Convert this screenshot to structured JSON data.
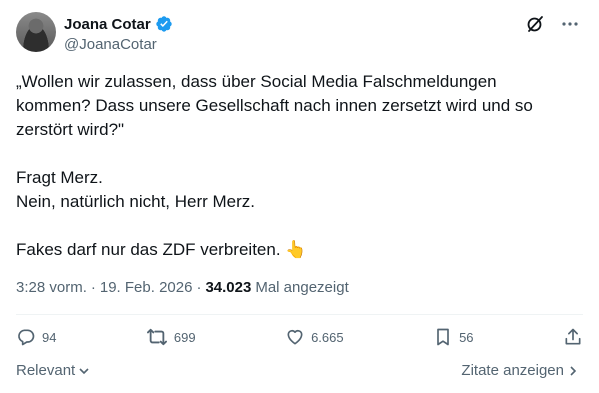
{
  "author": {
    "name": "Joana Cotar",
    "handle": "@JoanaCotar",
    "verified": true,
    "verified_color": "#1d9bf0"
  },
  "tweet": {
    "lines": [
      "„Wollen wir zulassen, dass über Social Media Falschmeldungen",
      "kommen? Dass unsere Gesellschaft nach innen zersetzt wird und so",
      "zerstört wird?\"",
      "",
      "Fragt Merz.",
      "Nein, natürlich nicht, Herr Merz.",
      "",
      "Fakes darf nur das ZDF verbreiten."
    ],
    "emoji": "👆"
  },
  "meta": {
    "time": "3:28 vorm.",
    "separator1": "·",
    "date": "19. Feb. 2026",
    "separator2": "·",
    "views_count": "34.023",
    "views_label": "Mal angezeigt"
  },
  "actions": {
    "replies": "94",
    "reposts": "699",
    "likes": "6.665",
    "bookmarks": "56"
  },
  "footer": {
    "sort_label": "Relevant",
    "quotes_label": "Zitate anzeigen"
  },
  "icons": {
    "grok": "grok-icon",
    "more": "more-icon",
    "reply": "reply-icon",
    "repost": "repost-icon",
    "like": "heart-icon",
    "bookmark": "bookmark-icon",
    "share": "share-icon"
  }
}
